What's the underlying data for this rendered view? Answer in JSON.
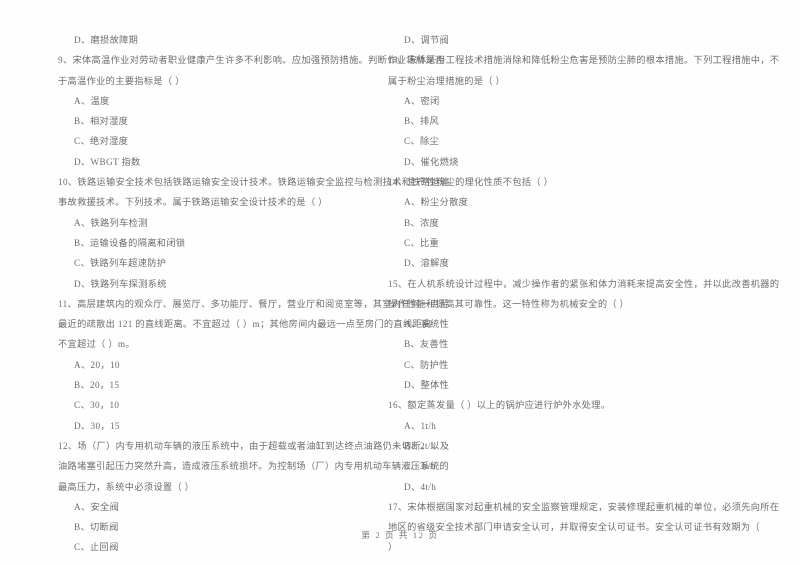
{
  "document": {
    "type": "exam-paper",
    "page_footer": "第 2 页 共 12 页",
    "page_number": 2,
    "total_pages": 12,
    "background_color": "#fefefe",
    "text_color": "#6d6d6e"
  },
  "left_column": {
    "blocks": [
      {
        "kind": "option",
        "lines": [
          "D、磨损故障期"
        ]
      },
      {
        "kind": "question",
        "number": "9",
        "lines": [
          "9、宋体高温作业对劳动者职业健康产生许多不利影响。应加强预防措施。判断作业场所是否",
          "于高温作业的主要指标是（      ）"
        ]
      },
      {
        "kind": "option",
        "lines": [
          "A、温度"
        ]
      },
      {
        "kind": "option",
        "lines": [
          "B、相对湿度"
        ]
      },
      {
        "kind": "option",
        "lines": [
          "C、绝对湿度"
        ]
      },
      {
        "kind": "option",
        "lines": [
          "D、WBGT 指数"
        ]
      },
      {
        "kind": "question",
        "number": "10",
        "lines": [
          "10、铁路运输安全技术包括铁路运输安全设计技术。铁路运输安全监控与检测技术和铁路运输",
          "事故救援技术。下列技术。属于铁路运输安全设计技术的是（      ）"
        ]
      },
      {
        "kind": "option",
        "lines": [
          "A、铁路列车检测"
        ]
      },
      {
        "kind": "option",
        "lines": [
          "B、运输设备的隔离和闭锁"
        ]
      },
      {
        "kind": "option",
        "lines": [
          "C、铁路列车超速防护"
        ]
      },
      {
        "kind": "option",
        "lines": [
          "D、铁路列车探测系统"
        ]
      },
      {
        "kind": "question",
        "number": "11",
        "lines": [
          "11、高层建筑内的观众厅、展览厅、多功能厅、餐厅，营业厅和阅览室等，其室内任何一点至",
          "最近的疏散出 121 的直线距离。不宜超过（      ）m；其他房间内最远一点至房门的直线距离",
          "不宜超过（      ）m。"
        ]
      },
      {
        "kind": "option",
        "lines": [
          "A、20，10"
        ]
      },
      {
        "kind": "option",
        "lines": [
          "B、20，15"
        ]
      },
      {
        "kind": "option",
        "lines": [
          "C、30，10"
        ]
      },
      {
        "kind": "option",
        "lines": [
          "D、30，15"
        ]
      },
      {
        "kind": "question",
        "number": "12",
        "lines": [
          "12、场（厂）内专用机动车辆的液压系统中，由于超载或者油缸到达终点油路仍未切断。以及",
          "油路堵塞引起压力突然升高，造成液压系统损坏。为控制场（厂）内专用机动车辆液压系统的",
          "最高压力，系统中必须设置（      ）"
        ]
      },
      {
        "kind": "option",
        "lines": [
          "A、安全阀"
        ]
      },
      {
        "kind": "option",
        "lines": [
          "B、切断阀"
        ]
      },
      {
        "kind": "option",
        "lines": [
          "C、止回阀"
        ]
      }
    ]
  },
  "right_column": {
    "blocks": [
      {
        "kind": "option",
        "lines": [
          "D、调节阀"
        ]
      },
      {
        "kind": "question",
        "number": "13",
        "lines": [
          "13、宋体采用工程技术措施消除和降低粉尘危害是预防尘肺的根本措施。下列工程措施中，不",
          "属于粉尘治理措施的是（      ）"
        ]
      },
      {
        "kind": "option",
        "lines": [
          "A、密闭"
        ]
      },
      {
        "kind": "option",
        "lines": [
          "B、排风"
        ]
      },
      {
        "kind": "option",
        "lines": [
          "C、除尘"
        ]
      },
      {
        "kind": "option",
        "lines": [
          "D、催化燃烧"
        ]
      },
      {
        "kind": "question",
        "number": "14",
        "lines": [
          "14、生产性粉尘的理化性质不包括（      ）"
        ]
      },
      {
        "kind": "option",
        "lines": [
          "A、粉尘分散度"
        ]
      },
      {
        "kind": "option",
        "lines": [
          "B、浓度"
        ]
      },
      {
        "kind": "option",
        "lines": [
          "C、比重"
        ]
      },
      {
        "kind": "option",
        "lines": [
          "D、溶解度"
        ]
      },
      {
        "kind": "question",
        "number": "15",
        "lines": [
          "15、在人机系统设计过程中，减少操作者的紧张和体力消耗来提高安全性，并以此改善机器的",
          "操作性能和提高其可靠性。这一特性称为机械安全的（      ）"
        ]
      },
      {
        "kind": "option",
        "lines": [
          "A、系统性"
        ]
      },
      {
        "kind": "option",
        "lines": [
          "B、友善性"
        ]
      },
      {
        "kind": "option",
        "lines": [
          "C、防护性"
        ]
      },
      {
        "kind": "option",
        "lines": [
          "D、整体性"
        ]
      },
      {
        "kind": "question",
        "number": "16",
        "lines": [
          "16、额定蒸发量（      ）以上的锅炉应进行炉外水处理。"
        ]
      },
      {
        "kind": "option",
        "lines": [
          "A、1t/h"
        ]
      },
      {
        "kind": "option",
        "lines": [
          "B、2t/h"
        ]
      },
      {
        "kind": "option",
        "lines": [
          "C、3t/h"
        ]
      },
      {
        "kind": "option",
        "lines": [
          "D、4t/h"
        ]
      },
      {
        "kind": "question",
        "number": "17",
        "lines": [
          "17、宋体根据国家对起重机械的安全监察管理规定，安装修理起重机械的单位，必须先向所在",
          "地区的省级安全技术部门申请安全认可，并取得安全认可证书。安全认可证书有效期为（",
          "）"
        ]
      }
    ]
  }
}
